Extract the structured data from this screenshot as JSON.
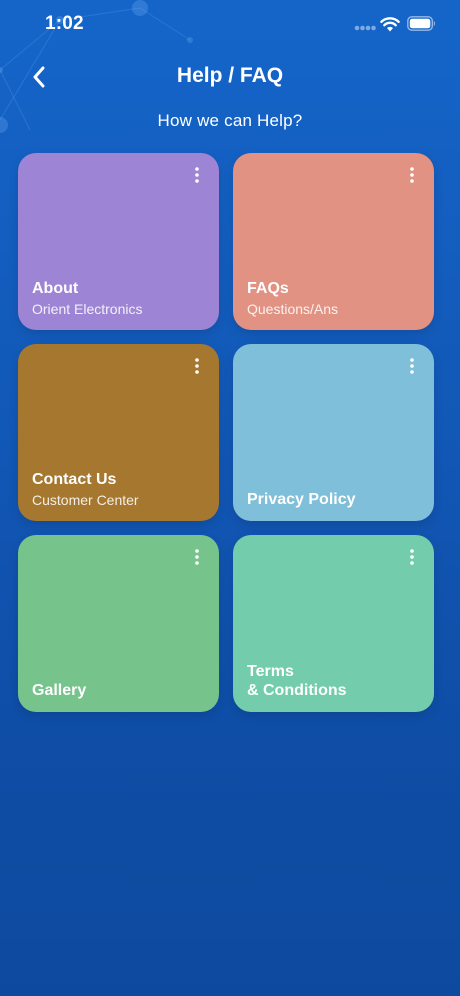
{
  "status_bar": {
    "time": "1:02"
  },
  "header": {
    "title": "Help / FAQ",
    "subtitle": "How we can Help?"
  },
  "cards": [
    {
      "title": "About",
      "subtitle": "Orient Electronics",
      "color": "#9d84d4"
    },
    {
      "title": "FAQs",
      "subtitle": "Questions/Ans",
      "color": "#e19282"
    },
    {
      "title": "Contact Us",
      "subtitle": "Customer Center",
      "color": "#a5772f"
    },
    {
      "title": "Privacy Policy",
      "subtitle": "",
      "color": "#7fbfd9"
    },
    {
      "title": "Gallery",
      "subtitle": "",
      "color": "#76c38b"
    },
    {
      "title": "Terms\n& Conditions",
      "subtitle": "",
      "color": "#73cdad"
    }
  ],
  "icons": {
    "back": "chevron-left-icon",
    "more": "more-vertical-icon",
    "wifi": "wifi-icon",
    "battery": "battery-icon",
    "signal": "signal-icon"
  },
  "colors": {
    "background_top": "#1565c9",
    "background_bottom": "#0d4a9f"
  }
}
